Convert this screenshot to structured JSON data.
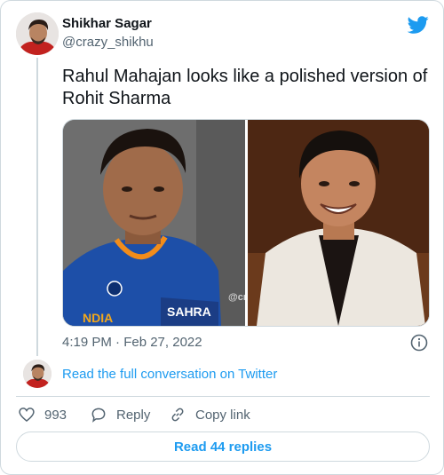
{
  "author": {
    "name": "Shikhar Sagar",
    "handle": "@crazy_shikhu"
  },
  "tweet": {
    "text": "Rahul Mahajan looks like a polished  version of Rohit Sharma",
    "watermark": "@crazy_shikhu",
    "timestamp": "4:19 PM · Feb 27, 2022",
    "jersey_text_left": "NDIA",
    "jersey_text_right": "SAHRA"
  },
  "conversation": {
    "read_full_label": "Read the full conversation on Twitter"
  },
  "actions": {
    "like_count": "993",
    "reply_label": "Reply",
    "copy_label": "Copy link",
    "read_replies_label": "Read 44 replies"
  },
  "colors": {
    "accent": "#1d9bf0",
    "text": "#0f1419",
    "secondary": "#536471",
    "border": "#cfd9de"
  },
  "icons": {
    "logo": "twitter-bird-icon",
    "info": "info-icon",
    "like": "heart-icon",
    "reply": "speech-bubble-icon",
    "copy": "link-icon"
  }
}
